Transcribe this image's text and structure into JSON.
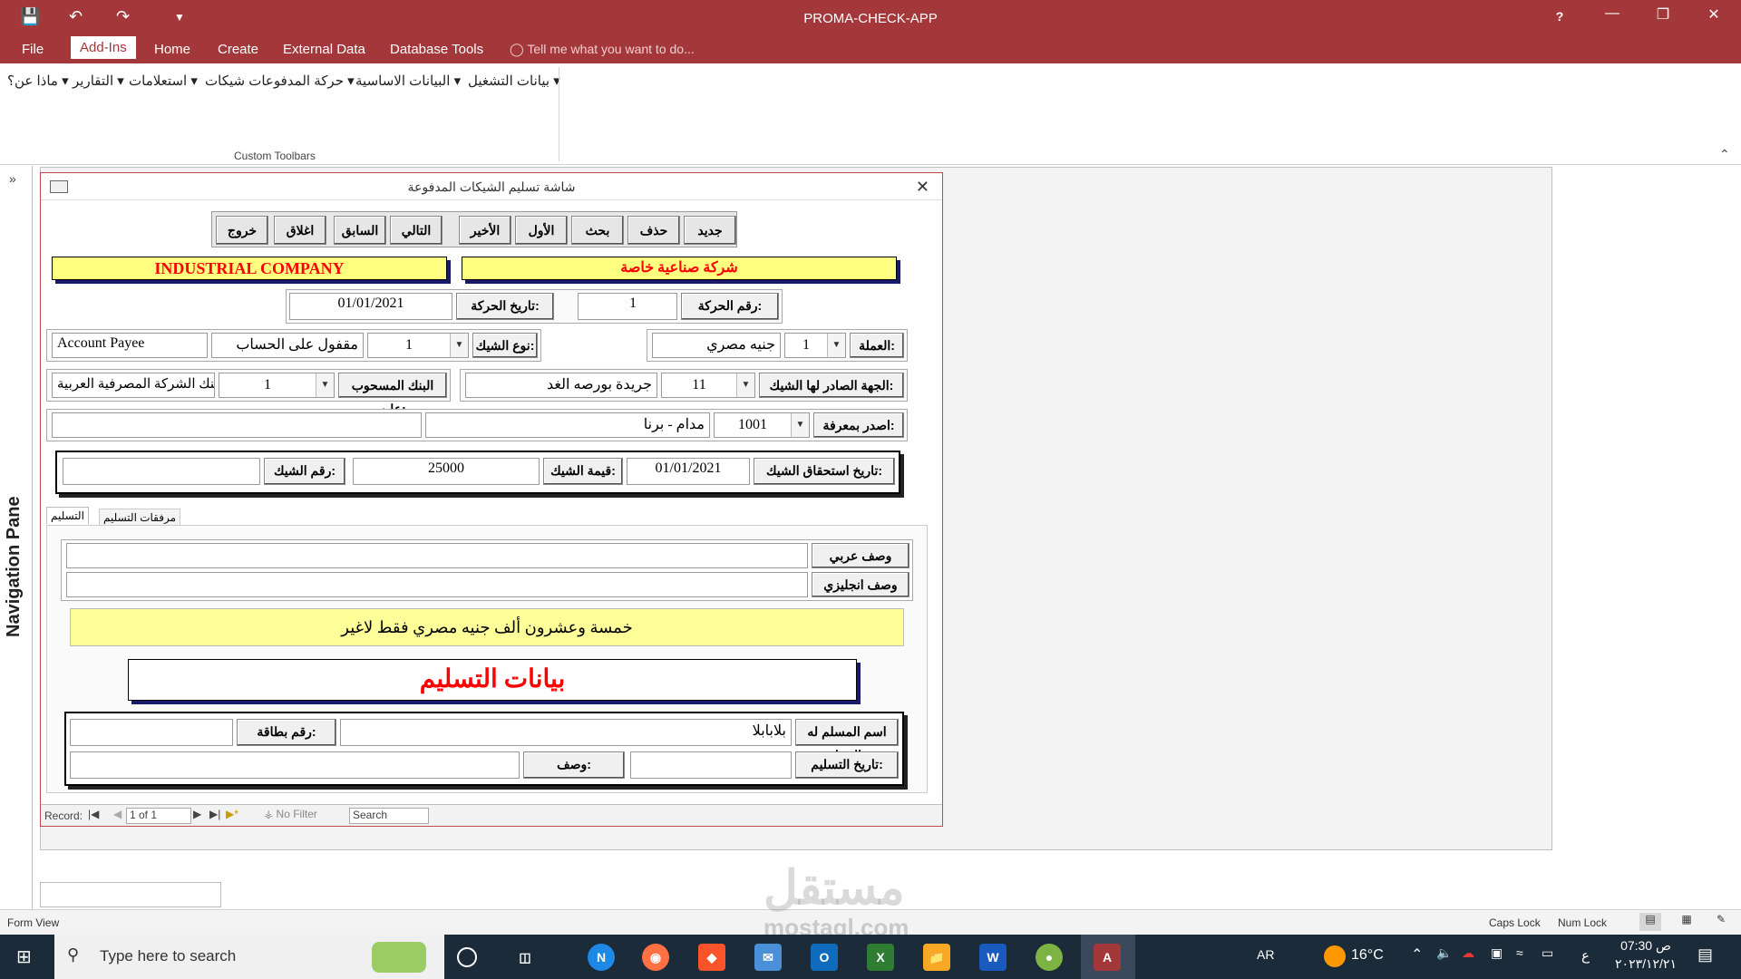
{
  "app": {
    "title": "PROMA-CHECK-APP",
    "help": "?"
  },
  "menu": {
    "file": "File",
    "addins": "Add-Ins",
    "home": "Home",
    "create": "Create",
    "external": "External Data",
    "dbtools": "Database Tools",
    "tell": "Tell me what you want to do..."
  },
  "ribbon": {
    "items": [
      "بيانات التشغيل",
      "البيانات الاساسية",
      "حركة المدفوعات شيكات",
      "استعلامات",
      "التقارير",
      "ماذا عن؟"
    ],
    "group_label": "Custom Toolbars"
  },
  "nav": {
    "label": "Navigation Pane"
  },
  "form": {
    "title": "شاشة تسليم الشيكات المدفوعة",
    "buttons": [
      "جديد",
      "حذف",
      "بحث",
      "الأول",
      "الأخير",
      "التالي",
      "السابق",
      "اغلاق",
      "خروج"
    ],
    "company_en": "INDUSTRIAL COMPANY",
    "company_ar": "شركة صناعية خاصة",
    "movement_no_label": "رقم الحركة:",
    "movement_no": "1",
    "movement_date_label": "تاريخ الحركة:",
    "movement_date": "01/01/2021",
    "currency_label": "العملة:",
    "currency_code": "1",
    "currency_name": "جنيه مصري",
    "check_type_label": "نوع الشيك:",
    "check_type_code": "1",
    "check_type_name": "مقفول على الحساب",
    "check_type_en": "Account Payee",
    "issued_to_label": "الجهة الصادر لها الشيك:",
    "issued_to_code": "11",
    "issued_to_name": "جريدة بورصه الغد",
    "bank_label": "البنك المسحوب عليه:",
    "bank_code": "1",
    "bank_name": "بنك الشركة المصرفية العربية",
    "issued_by_label": "اصدر بمعرفة:",
    "issued_by_code": "1001",
    "issued_by_name": "مدام - برنا",
    "issued_by_extra": "",
    "due_date_label": "تاريخ استحقاق الشيك:",
    "due_date": "01/01/2021",
    "check_value_label": "قيمة الشيك:",
    "check_value": "25000",
    "check_no_label": "رقم الشيك:",
    "check_no": "",
    "tab_delivery": "التسليم",
    "tab_attachments": "مرفقات التسليم",
    "desc_ar_label": "وصف عربي",
    "desc_ar": "",
    "desc_en_label": "وصف انجليزي",
    "desc_en": "",
    "amount_words": "خمسة وعشرون ألف جنيه مصري  فقط لاغير",
    "delivery_header": "بيانات التسليم",
    "receiver_label": "اسم المسلم له الشيك:",
    "receiver_name": "بلابابلا",
    "card_no_label": "رقم بطاقة:",
    "card_no": "",
    "delivery_date_label": "تاريخ التسليم:",
    "delivery_date": "",
    "desc_label": "وصف:",
    "desc": ""
  },
  "recordbar": {
    "record_label": "Record:",
    "position": "1 of 1",
    "filter": "No Filter",
    "search": "Search"
  },
  "status": {
    "view": "Form View",
    "caps": "Caps Lock",
    "num": "Num Lock"
  },
  "taskbar": {
    "search_placeholder": "Type here to search",
    "lang": "AR",
    "weather": "16°C",
    "time": "07:30 ص",
    "date": "٢٠٢٣/١٢/٢١",
    "input_char": "ع"
  },
  "watermark": {
    "text_ar": "مستقل",
    "text_en": "mostaql.com"
  }
}
